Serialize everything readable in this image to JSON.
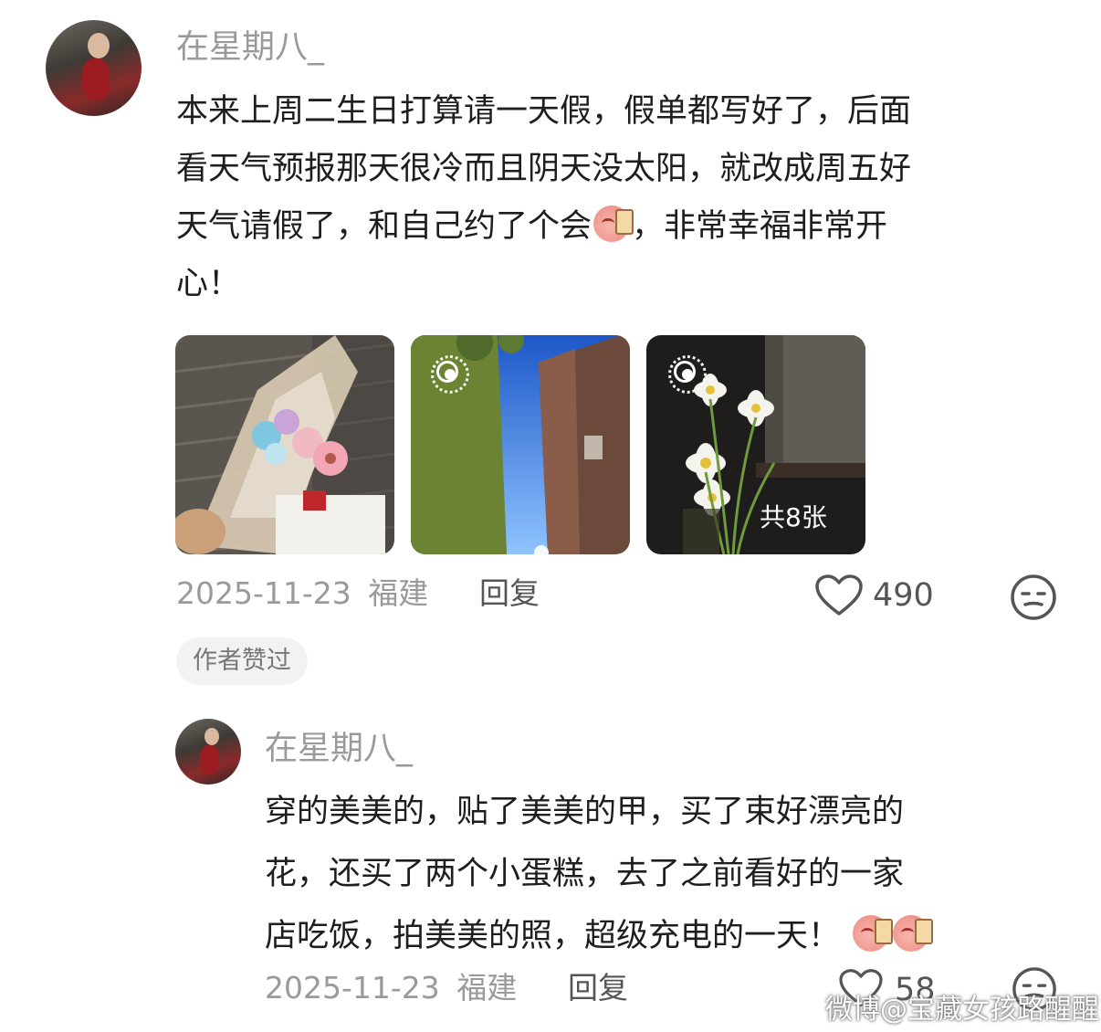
{
  "comments": [
    {
      "username": "在星期八_",
      "text_line1": "本来上周二生日打算请一天假，假单都写好了，后面",
      "text_line2": "看天气预报那天很冷而且阴天没太阳，就改成周五好",
      "text_line3a": "天气请假了，和自己约了个会",
      "text_line3b": "，非常幸福非常开",
      "text_line4": "心！",
      "images": [
        "flower-bouquet-photo",
        "sky-buildings-photo",
        "daisy-vase-photo"
      ],
      "image_count": "共8张",
      "date": "2025-11-23",
      "location": "福建",
      "reply_label": "回复",
      "likes": "490",
      "author_badge": "作者赞过"
    },
    {
      "username": "在星期八_",
      "text_line1": "穿的美美的，贴了美美的甲，买了束好漂亮的",
      "text_line2": "花，还买了两个小蛋糕，去了之前看好的一家",
      "text_line3": "店吃饭，拍美美的照，超级充电的一天！",
      "date": "2025-11-23",
      "location": "福建",
      "reply_label": "回复",
      "likes": "58"
    }
  ],
  "watermark": "微博@宝藏女孩路醒醒",
  "icons": {
    "like": "heart-outline-icon",
    "reaction": "meh-face-icon",
    "live": "live-photo-icon",
    "emoji": "peach-milk-tea-emoji"
  }
}
